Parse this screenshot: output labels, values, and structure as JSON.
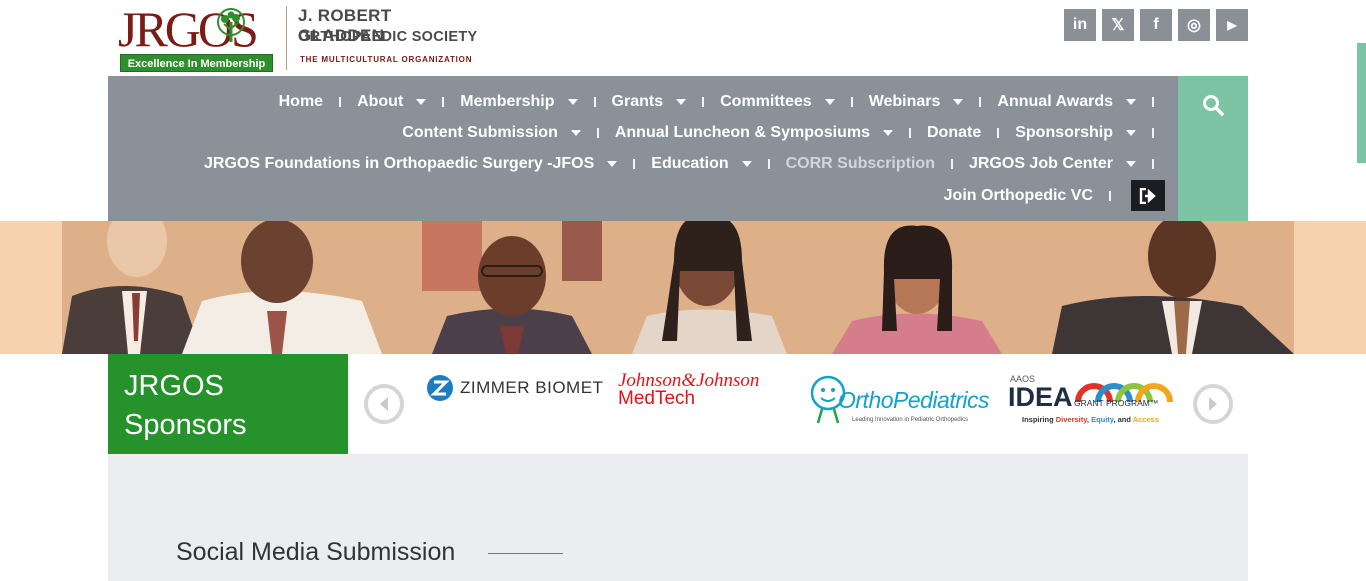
{
  "logo": {
    "letters": "JRGOS",
    "tagline": "Excellence In Membership",
    "name_line1": "J. ROBERT GLADDEN",
    "name_line2": "ORTHOPAEDIC SOCIETY",
    "name_line3": "THE MULTICULTURAL ORGANIZATION"
  },
  "social": [
    {
      "name": "linkedin-icon",
      "glyph": "in"
    },
    {
      "name": "x-icon",
      "glyph": "𝕏"
    },
    {
      "name": "facebook-icon",
      "glyph": "f"
    },
    {
      "name": "instagram-icon",
      "glyph": "◎"
    },
    {
      "name": "youtube-icon",
      "glyph": "▶"
    }
  ],
  "nav": {
    "home": "Home",
    "about": "About",
    "membership": "Membership",
    "grants": "Grants",
    "committees": "Committees",
    "webinars": "Webinars",
    "annual_awards": "Annual Awards",
    "content_submission": "Content Submission",
    "annual_luncheon": "Annual Luncheon & Symposiums",
    "donate": "Donate",
    "sponsorship": "Sponsorship",
    "jfos": "JRGOS Foundations in Orthopaedic Surgery -JFOS",
    "education": "Education",
    "corr": "CORR Subscription",
    "job_center": "JRGOS Job Center",
    "join_vc": "Join Orthopedic VC"
  },
  "sponsors": {
    "title_line1": "JRGOS",
    "title_line2": "Sponsors",
    "zimmer": "ZIMMER BIOMET",
    "jnj_line1": "Johnson&Johnson",
    "jnj_line2": "MedTech",
    "ortho_name": "OrthoPediatrics",
    "ortho_tagline": "Leading Innovation in Pediatric Orthopedics",
    "idea_aaos": "AAOS",
    "idea_main": "IDEA",
    "idea_program": "GRANT PROGRAM™",
    "idea_tagline_1": "Inspiring ",
    "idea_tagline_2": "Diversity",
    "idea_tagline_3": ", ",
    "idea_tagline_4": "Equity",
    "idea_tagline_5": ", and ",
    "idea_tagline_6": "Access"
  },
  "section": {
    "heading": "Social Media Submission"
  },
  "colors": {
    "brand_red": "#7a1b14",
    "brand_green": "#25922b",
    "nav_gray": "#8b9199",
    "accent_mint": "#7cc4a4"
  }
}
